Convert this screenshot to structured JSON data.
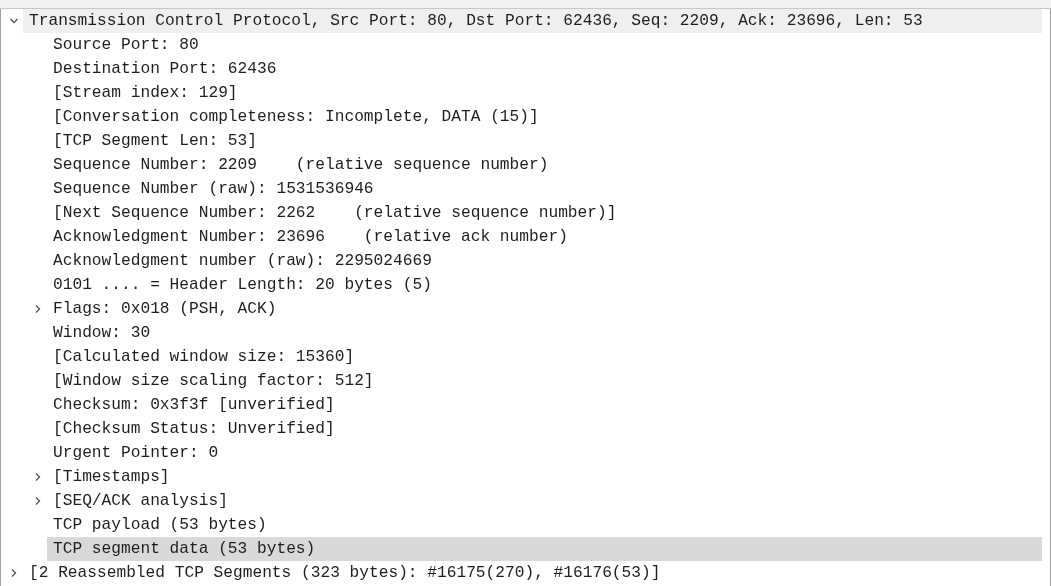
{
  "tree": [
    {
      "label": "Transmission Control Protocol, Src Port: 80, Dst Port: 62436, Seq: 2209, Ack: 23696, Len: 53",
      "expanded": true,
      "selected": false,
      "hovered": true,
      "children": [
        {
          "label": "Source Port: 80",
          "selected": false,
          "hovered": false
        },
        {
          "label": "Destination Port: 62436",
          "selected": false,
          "hovered": false
        },
        {
          "label": "[Stream index: 129]",
          "selected": false,
          "hovered": false
        },
        {
          "label": "[Conversation completeness: Incomplete, DATA (15)]",
          "selected": false,
          "hovered": false
        },
        {
          "label": "[TCP Segment Len: 53]",
          "selected": false,
          "hovered": false
        },
        {
          "label": "Sequence Number: 2209    (relative sequence number)",
          "selected": false,
          "hovered": false
        },
        {
          "label": "Sequence Number (raw): 1531536946",
          "selected": false,
          "hovered": false
        },
        {
          "label": "[Next Sequence Number: 2262    (relative sequence number)]",
          "selected": false,
          "hovered": false
        },
        {
          "label": "Acknowledgment Number: 23696    (relative ack number)",
          "selected": false,
          "hovered": false
        },
        {
          "label": "Acknowledgment number (raw): 2295024669",
          "selected": false,
          "hovered": false
        },
        {
          "label": "0101 .... = Header Length: 20 bytes (5)",
          "selected": false,
          "hovered": false
        },
        {
          "label": "Flags: 0x018 (PSH, ACK)",
          "expanded": false,
          "selected": false,
          "hovered": false
        },
        {
          "label": "Window: 30",
          "selected": false,
          "hovered": false
        },
        {
          "label": "[Calculated window size: 15360]",
          "selected": false,
          "hovered": false
        },
        {
          "label": "[Window size scaling factor: 512]",
          "selected": false,
          "hovered": false
        },
        {
          "label": "Checksum: 0x3f3f [unverified]",
          "selected": false,
          "hovered": false
        },
        {
          "label": "[Checksum Status: Unverified]",
          "selected": false,
          "hovered": false
        },
        {
          "label": "Urgent Pointer: 0",
          "selected": false,
          "hovered": false
        },
        {
          "label": "[Timestamps]",
          "expanded": false,
          "selected": false,
          "hovered": false
        },
        {
          "label": "[SEQ/ACK analysis]",
          "expanded": false,
          "selected": false,
          "hovered": false
        },
        {
          "label": "TCP payload (53 bytes)",
          "selected": false,
          "hovered": false
        },
        {
          "label": "TCP segment data (53 bytes)",
          "selected": true,
          "hovered": false
        }
      ]
    },
    {
      "label": "[2 Reassembled TCP Segments (323 bytes): #16175(270), #16176(53)]",
      "expanded": false,
      "selected": false,
      "hovered": false
    }
  ]
}
